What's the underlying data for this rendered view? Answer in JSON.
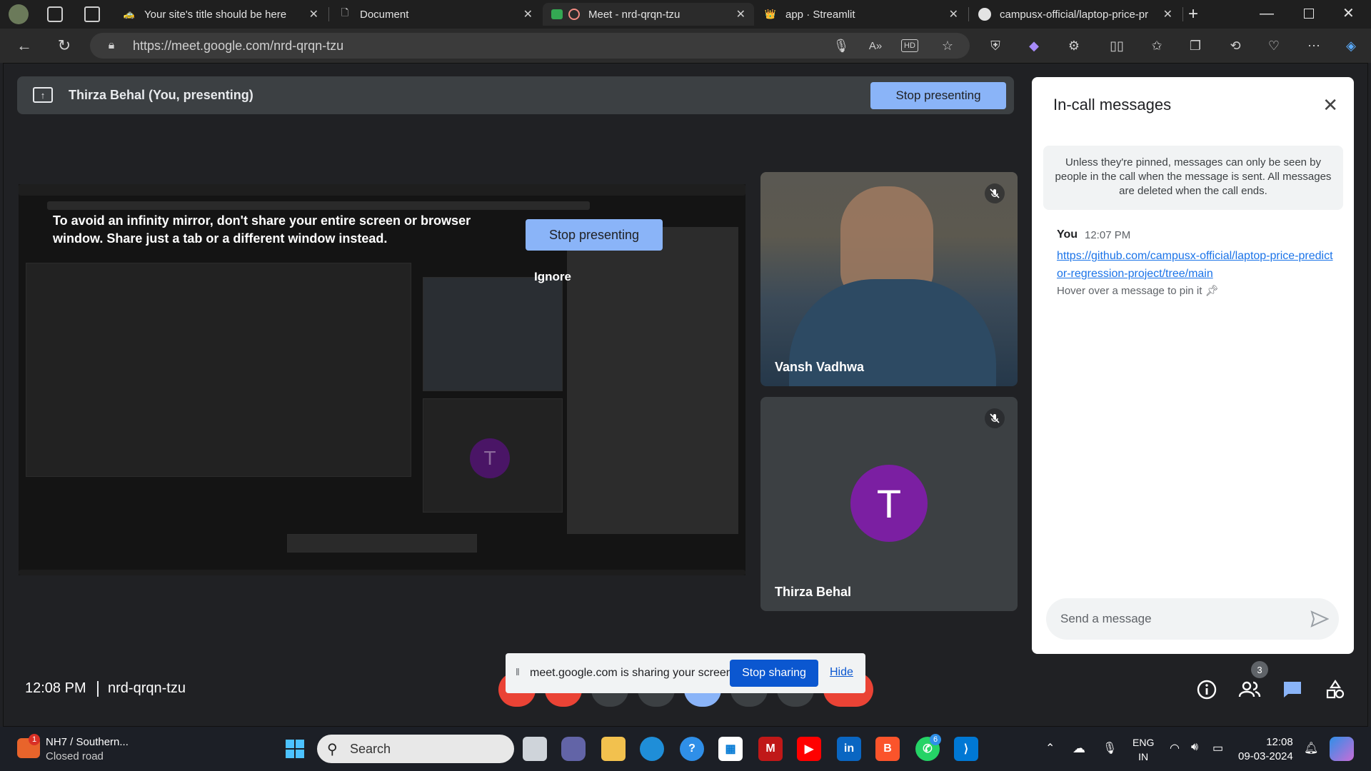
{
  "browser": {
    "tabs": [
      {
        "title": "Your site's title should be here",
        "active": false
      },
      {
        "title": "Document",
        "active": false
      },
      {
        "title": "Meet - nrd-qrqn-tzu",
        "active": true
      },
      {
        "title": "app · Streamlit",
        "active": false
      },
      {
        "title": "campusx-official/laptop-price-pr",
        "active": false
      }
    ],
    "url": "https://meet.google.com/nrd-qrqn-tzu"
  },
  "meet": {
    "presenting_label": "Thirza Behal (You, presenting)",
    "stop_presenting_label": "Stop presenting",
    "mirror_warning": "To avoid an infinity mirror, don't share your entire screen or browser window. Share just a tab or a different window instead.",
    "ignore_label": "Ignore",
    "participants": [
      {
        "name": "Vansh Vadhwa",
        "muted": true
      },
      {
        "name": "Thirza Behal",
        "initial": "T",
        "muted": true,
        "avatar_color": "#7b1fa2"
      }
    ],
    "time": "12:08 PM",
    "meeting_code": "nrd-qrqn-tzu",
    "people_count": "3",
    "share_banner": {
      "text": "meet.google.com is sharing your screen.",
      "stop_label": "Stop sharing",
      "hide_label": "Hide"
    }
  },
  "messages": {
    "title": "In-call messages",
    "notice": "Unless they're pinned, messages can only be seen by people in the call when the message is sent. All messages are deleted when the call ends.",
    "items": [
      {
        "sender": "You",
        "time": "12:07 PM",
        "text": "https://github.com/campusx-official/laptop-price-predictor-regression-project/tree/main"
      }
    ],
    "hint": "Hover over a message to pin it",
    "input_placeholder": "Send a message"
  },
  "taskbar": {
    "weather_title": "NH7 / Southern...",
    "weather_sub": "Closed road",
    "weather_badge": "1",
    "search_placeholder": "Search",
    "whatsapp_badge": "6",
    "lang_top": "ENG",
    "lang_bottom": "IN",
    "clock_time": "12:08",
    "clock_date": "09-03-2024"
  },
  "colors": {
    "meet_bg": "#202124",
    "accent_blue": "#8ab4f8",
    "stop_sharing_blue": "#0b57d0",
    "end_call_red": "#ea4335"
  }
}
